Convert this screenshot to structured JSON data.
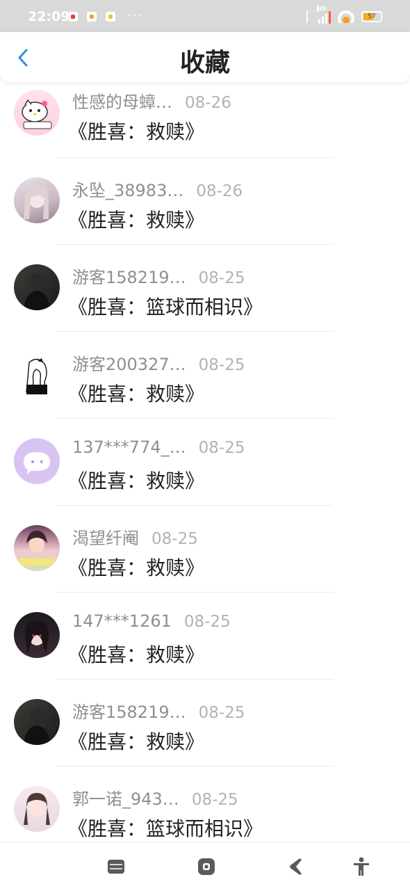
{
  "status_bar": {
    "time": "22:09",
    "dots": "···",
    "network_label": "HD",
    "battery": "57"
  },
  "header": {
    "title": "收藏"
  },
  "favorites": [
    {
      "user": "性感的母蟑…",
      "date": "08-26",
      "title": "《胜喜：救赎》"
    },
    {
      "user": "永坠_38983…",
      "date": "08-26",
      "title": "《胜喜：救赎》"
    },
    {
      "user": "游客158219…",
      "date": "08-25",
      "title": "《胜喜：篮球而相识》"
    },
    {
      "user": "游客200327…",
      "date": "08-25",
      "title": "《胜喜：救赎》"
    },
    {
      "user": "137***774_…",
      "date": "08-25",
      "title": "《胜喜：救赎》"
    },
    {
      "user": "渴望纤阉",
      "date": "08-25",
      "title": "《胜喜：救赎》"
    },
    {
      "user": "147***1261",
      "date": "08-25",
      "title": "《胜喜：救赎》"
    },
    {
      "user": "游客158219…",
      "date": "08-25",
      "title": "《胜喜：救赎》"
    },
    {
      "user": "郭一诺_943…",
      "date": "08-25",
      "title": "《胜喜：篮球而相识》"
    }
  ],
  "icons": {
    "back": "back-chevron-icon",
    "nav": [
      "menu-icon",
      "home-icon",
      "back-icon",
      "accessibility-icon"
    ]
  },
  "colors": {
    "accent": "#2f8fe8",
    "username": "#8f8f8f",
    "date": "#b2b2b2",
    "title": "#222222"
  }
}
